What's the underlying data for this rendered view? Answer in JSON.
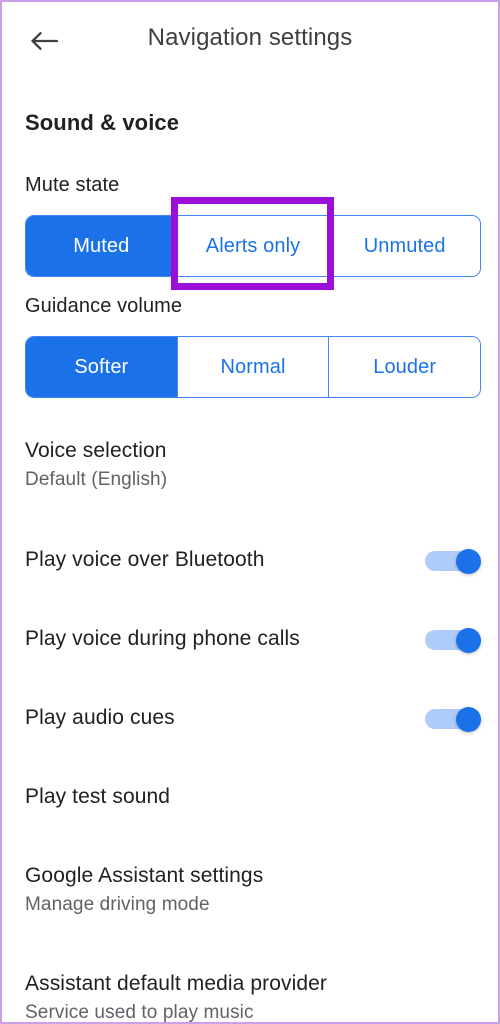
{
  "appbar": {
    "back_icon": "arrow-left-icon",
    "title": "Navigation settings"
  },
  "section": {
    "heading": "Sound & voice"
  },
  "mute_state": {
    "label": "Mute state",
    "options": [
      {
        "label": "Muted",
        "selected": true
      },
      {
        "label": "Alerts only",
        "selected": false
      },
      {
        "label": "Unmuted",
        "selected": false
      }
    ]
  },
  "guidance_volume": {
    "label": "Guidance volume",
    "options": [
      {
        "label": "Softer",
        "selected": true
      },
      {
        "label": "Normal",
        "selected": false
      },
      {
        "label": "Louder",
        "selected": false
      }
    ]
  },
  "rows": {
    "voice_selection": {
      "title": "Voice selection",
      "subtitle": "Default (English)"
    },
    "play_voice_bluetooth": {
      "title": "Play voice over Bluetooth",
      "toggle_on": true
    },
    "play_voice_calls": {
      "title": "Play voice during phone calls",
      "toggle_on": true
    },
    "play_audio_cues": {
      "title": "Play audio cues",
      "toggle_on": true
    },
    "play_test_sound": {
      "title": "Play test sound"
    },
    "assistant_settings": {
      "title": "Google Assistant settings",
      "subtitle": "Manage driving mode"
    },
    "media_provider": {
      "title": "Assistant default media provider",
      "subtitle": "Service used to play music"
    }
  },
  "annotation": {
    "target": "Alerts only",
    "color": "#9b0fd8"
  },
  "colors": {
    "accent_blue": "#1b72e8",
    "link_blue": "#1a73e8",
    "toggle_track": "#aecbfa",
    "text_primary": "#202124",
    "text_secondary": "#5f6368",
    "frame_border": "#cba0e8"
  }
}
